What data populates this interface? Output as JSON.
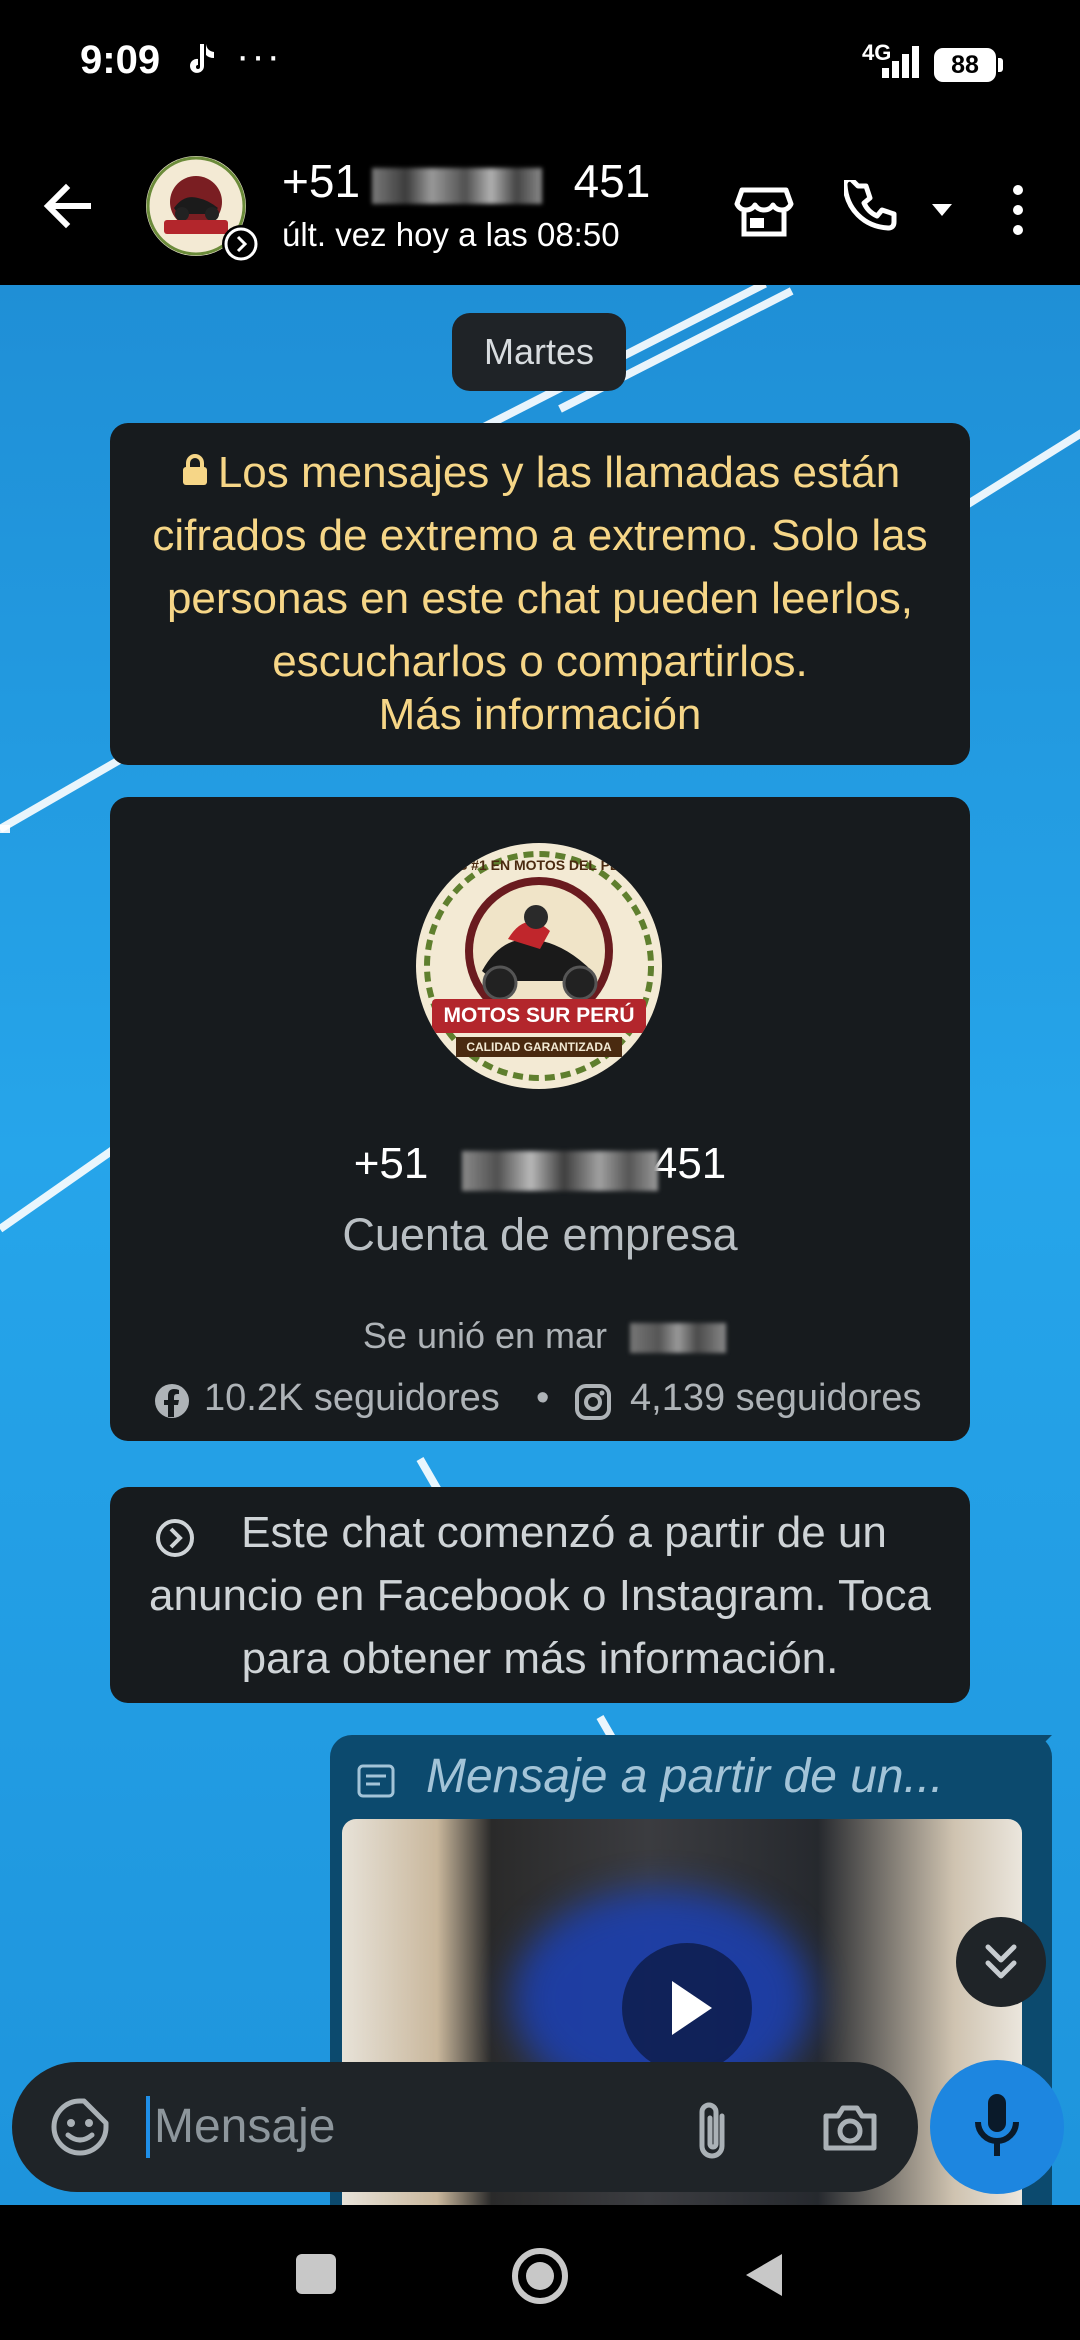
{
  "status_bar": {
    "time": "9:09",
    "overflow_dots": "···",
    "network": "4G",
    "battery": "88"
  },
  "header": {
    "contact_prefix": "+51",
    "contact_suffix": "451",
    "last_seen": "últ. vez hoy a las 08:50"
  },
  "chat": {
    "date_chip": "Martes",
    "encryption_notice": "Los mensajes y las llamadas están cifrados de extremo a extremo. Solo las personas en este chat pueden leerlos, escucharlos o compartirlos.",
    "encryption_link": "Más información",
    "business": {
      "logo_top_text": "LOS #1 EN MOTOS DEL PERÚ",
      "logo_brand": "MOTOS SUR PERÚ",
      "logo_tagline": "CALIDAD GARANTIZADA",
      "phone_prefix": "+51",
      "phone_suffix": "451",
      "account_type": "Cuenta de empresa",
      "joined": "Se unió en mar",
      "facebook_followers": "10.2K seguidores",
      "separator": "•",
      "instagram_followers": "4,139 seguidores"
    },
    "ad_notice": "Este chat comenzó a partir de un anuncio en Facebook o Instagram. Toca para obtener más información.",
    "outgoing": {
      "ad_message_label": "Mensaje a partir de un..."
    }
  },
  "composer": {
    "placeholder": "Mensaje"
  },
  "colors": {
    "encryption_text": "#f6d687",
    "outgoing_bubble": "#0c4a6e",
    "mic_button": "#1d86e0",
    "chat_bg": "#1f8fd6"
  }
}
